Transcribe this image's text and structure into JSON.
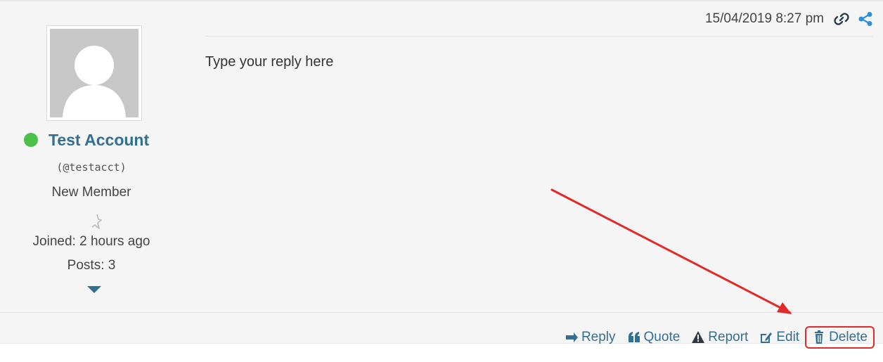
{
  "author": {
    "name": "Test Account",
    "username": "(@testacct)",
    "title": "New Member",
    "joined": "Joined: 2 hours ago",
    "posts": "Posts: 3",
    "status_color": "#4ac24a"
  },
  "post": {
    "date": "15/04/2019 8:27 pm",
    "body": "Type your reply here",
    "icons": [
      "link-icon",
      "share-icon"
    ]
  },
  "actions": {
    "reply": "Reply",
    "quote": "Quote",
    "report": "Report",
    "edit": "Edit",
    "delete": "Delete"
  },
  "colors": {
    "link": "#336e93",
    "share": "#2f8fd8",
    "highlight": "#e12a2a"
  }
}
